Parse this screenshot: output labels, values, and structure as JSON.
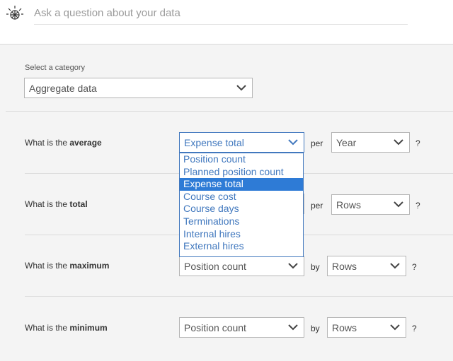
{
  "search": {
    "placeholder": "Ask a question about your data"
  },
  "category": {
    "label": "Select a category",
    "value": "Aggregate data"
  },
  "rows": [
    {
      "prefix": "What is the ",
      "metric": "average",
      "measure": "Expense total",
      "connector": "per",
      "group": "Year",
      "suffix": "?"
    },
    {
      "prefix": "What is the ",
      "metric": "total",
      "measure": "",
      "connector": "per",
      "group": "Rows",
      "suffix": "?"
    },
    {
      "prefix": "What is the ",
      "metric": "maximum",
      "measure": "Position count",
      "connector": "by",
      "group": "Rows",
      "suffix": "?"
    },
    {
      "prefix": "What is the ",
      "metric": "minimum",
      "measure": "Position count",
      "connector": "by",
      "group": "Rows",
      "suffix": "?"
    }
  ],
  "dropdown": {
    "options": [
      "Position count",
      "Planned position count",
      "Expense total",
      "Course cost",
      "Course days",
      "Terminations",
      "Internal hires",
      "External hires"
    ],
    "selected": "Expense total"
  },
  "colors": {
    "accent": "#4178be",
    "selected_bg": "#2e7bd6",
    "background": "#f4f4f4"
  },
  "icons": {
    "logo": "ibm-watson-logo",
    "chevron": "chevron-down-icon"
  }
}
